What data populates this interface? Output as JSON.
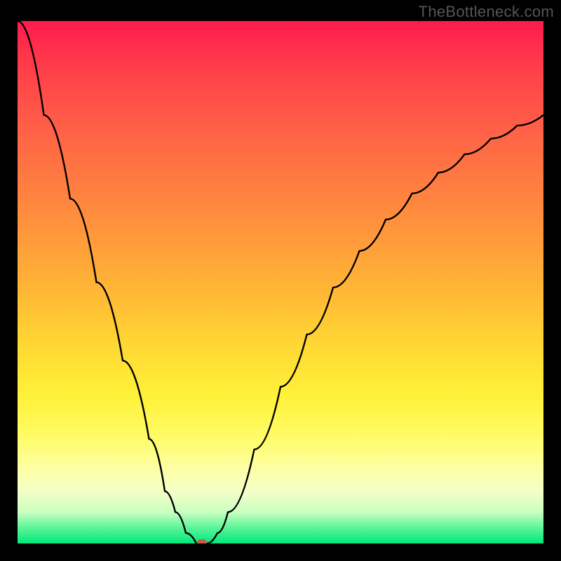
{
  "watermark": "TheBottleneck.com",
  "colors": {
    "frame_bg": "#000000",
    "curve": "#000000",
    "marker": "#c85a4a",
    "gradient_stops": [
      "#ff1a4d",
      "#ff6446",
      "#ffb236",
      "#fff23a",
      "#fdffa8",
      "#5bf59a",
      "#00e87a"
    ]
  },
  "chart_data": {
    "type": "line",
    "title": "",
    "xlabel": "",
    "ylabel": "",
    "xlim": [
      0,
      100
    ],
    "ylim": [
      0,
      100
    ],
    "grid": false,
    "legend": null,
    "annotations": [],
    "series": [
      {
        "name": "bottleneck-curve",
        "x": [
          0,
          5,
          10,
          15,
          20,
          25,
          28,
          30,
          32,
          34,
          36,
          38,
          40,
          45,
          50,
          55,
          60,
          65,
          70,
          75,
          80,
          85,
          90,
          95,
          100
        ],
        "y": [
          100,
          82,
          66,
          50,
          35,
          20,
          10,
          6,
          2,
          0,
          0,
          2,
          6,
          18,
          30,
          40,
          49,
          56,
          62,
          67,
          71,
          74.5,
          77.5,
          80,
          82
        ]
      }
    ],
    "marker": {
      "x": 35,
      "y": 0
    }
  }
}
